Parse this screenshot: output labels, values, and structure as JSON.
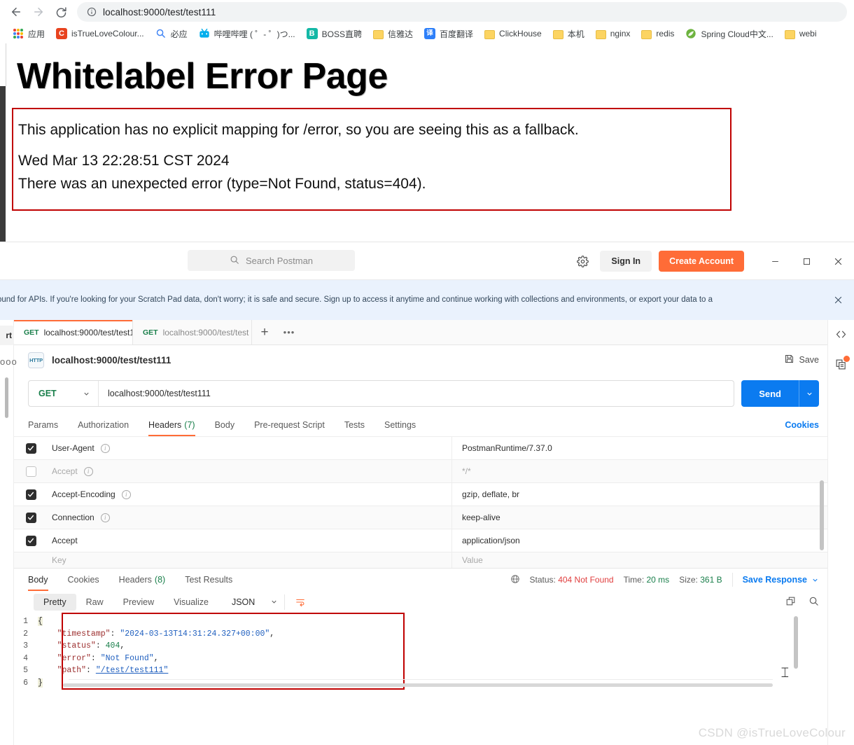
{
  "browser": {
    "url": "localhost:9000/test/test111",
    "back_label": "Back",
    "forward_label": "Forward",
    "reload_label": "Reload",
    "site_info_label": "Site information",
    "bookmarks": [
      {
        "label": "应用",
        "icon": "apps-grid-icon",
        "kind": "apps"
      },
      {
        "label": "isTrueLoveColour...",
        "icon": "csdn-icon",
        "kind": "square",
        "letter": "C",
        "color": "#e8431f"
      },
      {
        "label": "必应",
        "icon": "bing-search-icon",
        "kind": "bing"
      },
      {
        "label": "哔哩哔哩 ( ゜- ゜)つ...",
        "icon": "bilibili-icon",
        "kind": "bili"
      },
      {
        "label": "BOSS直聘",
        "icon": "boss-icon",
        "kind": "square",
        "letter": "B",
        "color": "#14b8a6"
      },
      {
        "label": "信雅达",
        "icon": "folder-icon",
        "kind": "folder"
      },
      {
        "label": "百度翻译",
        "icon": "translate-icon",
        "kind": "square",
        "letter": "译",
        "color": "#2d7ff9"
      },
      {
        "label": "ClickHouse",
        "icon": "folder-icon",
        "kind": "folder"
      },
      {
        "label": "本机",
        "icon": "folder-icon",
        "kind": "folder"
      },
      {
        "label": "nginx",
        "icon": "folder-icon",
        "kind": "folder"
      },
      {
        "label": "redis",
        "icon": "folder-icon",
        "kind": "folder"
      },
      {
        "label": "Spring Cloud中文...",
        "icon": "spring-leaf-icon",
        "kind": "spring"
      },
      {
        "label": "webi",
        "icon": "folder-icon",
        "kind": "folder"
      }
    ]
  },
  "error_page": {
    "title": "Whitelabel Error Page",
    "line1": "This application has no explicit mapping for /error, so you are seeing this as a fallback.",
    "line2": "Wed Mar 13 22:28:51 CST 2024",
    "line3": "There was an unexpected error (type=Not Found, status=404).",
    "box_border_color": "#c00000"
  },
  "postman": {
    "search_placeholder": "Search Postman",
    "settings_label": "Settings",
    "sign_in_label": "Sign In",
    "create_account_label": "Create Account",
    "minimize_label": "Minimize",
    "maximize_label": "Maximize",
    "close_label": "Close",
    "accent_color": "#ff6c37",
    "banner": {
      "text": "ound for APIs. If you're looking for your Scratch Pad data, don't worry; it is safe and secure. Sign up to access it anytime and continue working with collections and environments, or export your data to a",
      "close_label": "Dismiss"
    },
    "left_rail": {
      "partial_tab": "rt",
      "overflow_label": "ooo"
    },
    "tabs": [
      {
        "method": "GET",
        "label": "localhost:9000/test/test1",
        "active": true
      },
      {
        "method": "GET",
        "label": "localhost:9000/test/test",
        "active": false
      }
    ],
    "new_tab_label": "+",
    "tab_overflow_label": "•••",
    "request": {
      "protocol_badge": "HTTP",
      "title": "localhost:9000/test/test111",
      "save_label": "Save",
      "method": "GET",
      "url": "localhost:9000/test/test111",
      "send_label": "Send",
      "cookies_label": "Cookies",
      "tabs": [
        {
          "label": "Params",
          "count": "",
          "active": false
        },
        {
          "label": "Authorization",
          "count": "",
          "active": false
        },
        {
          "label": "Headers",
          "count": "(7)",
          "active": true
        },
        {
          "label": "Body",
          "count": "",
          "active": false
        },
        {
          "label": "Pre-request Script",
          "count": "",
          "active": false
        },
        {
          "label": "Tests",
          "count": "",
          "active": false
        },
        {
          "label": "Settings",
          "count": "",
          "active": false
        }
      ],
      "headers": [
        {
          "checked": true,
          "key": "User-Agent",
          "info": true,
          "value": "PostmanRuntime/7.37.0",
          "dim": false
        },
        {
          "checked": false,
          "key": "Accept",
          "info": true,
          "value": "*/*",
          "dim": true
        },
        {
          "checked": true,
          "key": "Accept-Encoding",
          "info": true,
          "value": "gzip, deflate, br",
          "dim": false
        },
        {
          "checked": true,
          "key": "Connection",
          "info": true,
          "value": "keep-alive",
          "dim": false
        },
        {
          "checked": true,
          "key": "Accept",
          "info": false,
          "value": "application/json",
          "dim": false
        }
      ],
      "new_row_key_placeholder": "Key",
      "new_row_value_placeholder": "Value"
    },
    "response": {
      "tabs": [
        {
          "label": "Body",
          "count": "",
          "active": true
        },
        {
          "label": "Cookies",
          "count": "",
          "active": false
        },
        {
          "label": "Headers",
          "count": "(8)",
          "active": false
        },
        {
          "label": "Test Results",
          "count": "",
          "active": false
        }
      ],
      "status_label": "Status:",
      "status_value": "404 Not Found",
      "time_label": "Time:",
      "time_value": "20 ms",
      "size_label": "Size:",
      "size_value": "361 B",
      "save_response_label": "Save Response",
      "format_tabs": [
        {
          "label": "Pretty",
          "active": true
        },
        {
          "label": "Raw",
          "active": false
        },
        {
          "label": "Preview",
          "active": false
        },
        {
          "label": "Visualize",
          "active": false
        }
      ],
      "language": "JSON",
      "wrap_label": "Wrap lines",
      "copy_label": "Copy to clipboard",
      "search_label": "Search",
      "body_border_color": "#c00000",
      "line_numbers": [
        "1",
        "2",
        "3",
        "4",
        "5",
        "6"
      ],
      "json": {
        "open_brace": "{",
        "close_brace": "}",
        "entries": [
          {
            "key": "\"timestamp\"",
            "sep": ": ",
            "value": "\"2024-03-13T14:31:24.327+00:00\"",
            "type": "string",
            "comma": ","
          },
          {
            "key": "\"status\"",
            "sep": ": ",
            "value": "404",
            "type": "number",
            "comma": ","
          },
          {
            "key": "\"error\"",
            "sep": ": ",
            "value": "\"Not Found\"",
            "type": "string",
            "comma": ","
          },
          {
            "key": "\"path\"",
            "sep": ": ",
            "value": "\"/test/test111\"",
            "type": "link",
            "comma": ""
          }
        ]
      }
    },
    "right_rail": [
      {
        "icon": "code-snippet-icon",
        "label": "Code"
      },
      {
        "icon": "documentation-icon",
        "label": "Comments",
        "badge": true
      }
    ]
  },
  "watermark": "CSDN @isTrueLoveColour"
}
